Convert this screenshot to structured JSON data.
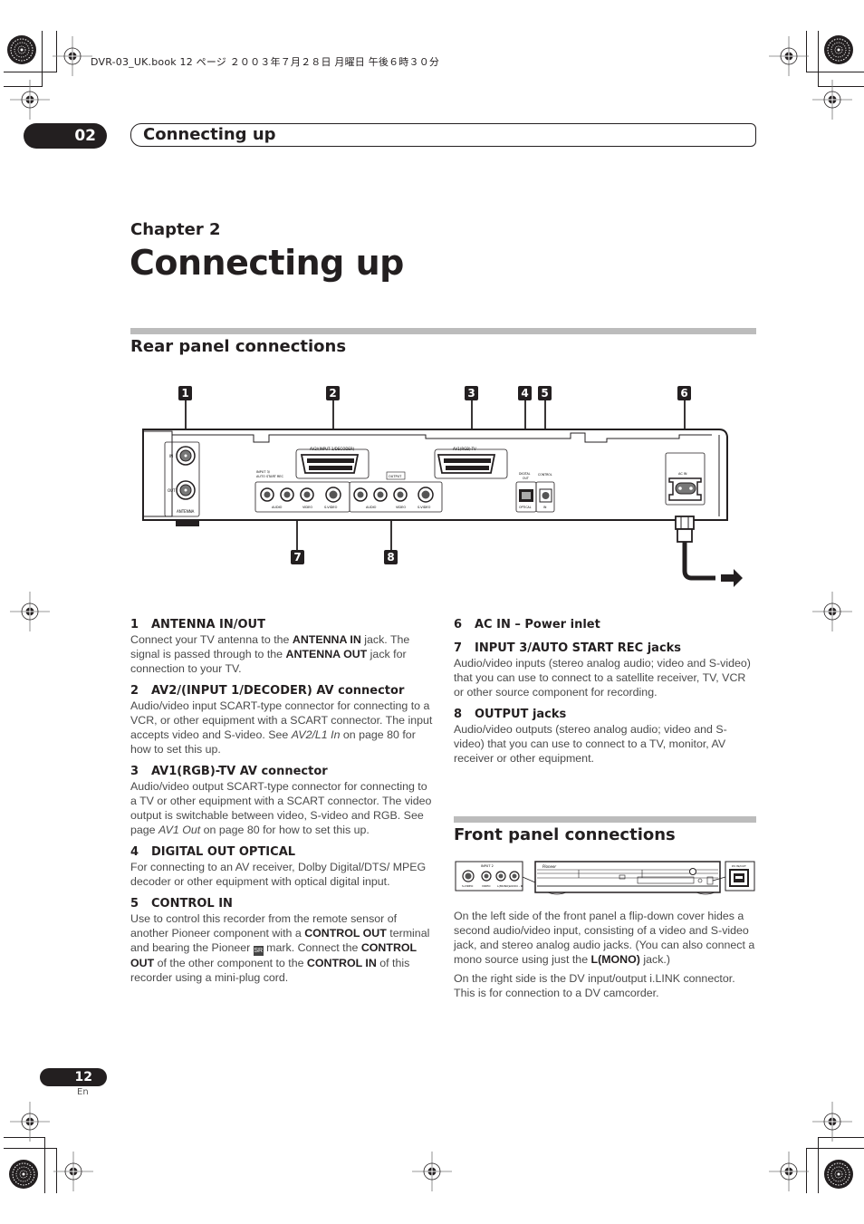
{
  "print_header": "DVR-03_UK.book  12 ページ  ２００３年７月２８日  月曜日  午後６時３０分",
  "chapter_header": {
    "number": "02",
    "title": "Connecting up"
  },
  "chapter_label": "Chapter 2",
  "page_title": "Connecting up",
  "rear_panel": {
    "title": "Rear panel connections",
    "callouts": [
      "1",
      "2",
      "3",
      "4",
      "5",
      "6",
      "7",
      "8"
    ],
    "diagram_labels": {
      "antenna_in": "IN",
      "antenna_out": "OUT",
      "antenna": "ANTENNA",
      "av2": "AV2/(INPUT 1/DECODER)",
      "av1": "AV1(RGB)-TV",
      "input3_line1": "INPUT 3/",
      "input3_line2": "AUTO START REC",
      "output": "OUTPUT",
      "r": "R",
      "l": "L",
      "audio": "AUDIO",
      "video": "VIDEO",
      "svideo": "S-VIDEO",
      "digital_out_1": "DIGITAL",
      "digital_out_2": "OUT",
      "optical": "OPTICAL",
      "control": "CONTROL",
      "control_in": "IN",
      "ac_in": "AC IN"
    },
    "items_left": [
      {
        "num": "1",
        "title": "ANTENNA IN/OUT",
        "body": [
          {
            "t": "Connect your TV antenna to the "
          },
          {
            "t": "ANTENNA IN",
            "s": "b"
          },
          {
            "t": " jack. The signal is passed through to the "
          },
          {
            "t": "ANTENNA OUT",
            "s": "b"
          },
          {
            "t": " jack for connection to your TV."
          }
        ]
      },
      {
        "num": "2",
        "title": "AV2/(INPUT 1/DECODER) AV connector",
        "body": [
          {
            "t": "Audio/video input SCART-type connector for connecting to a VCR, or other equipment with a SCART connector. The input accepts video and S-video. See "
          },
          {
            "t": "AV2/L1 In",
            "s": "i"
          },
          {
            "t": " on page 80 for how to set this up."
          }
        ]
      },
      {
        "num": "3",
        "title": "AV1(RGB)-TV AV connector",
        "body": [
          {
            "t": "Audio/video output SCART-type connector for connecting to a TV or other equipment with a SCART connector. The video output is switchable between video, S-video and RGB. See page "
          },
          {
            "t": "AV1 Out",
            "s": "i"
          },
          {
            "t": " on page 80 for how to set this up."
          }
        ]
      },
      {
        "num": "4",
        "title": "DIGITAL OUT OPTICAL",
        "body": [
          {
            "t": "For connecting to an AV receiver, Dolby Digital/DTS/ MPEG decoder or other equipment with optical digital input."
          }
        ]
      },
      {
        "num": "5",
        "title": "CONTROL IN",
        "body": [
          {
            "t": "Use to control this recorder from the remote sensor of another Pioneer component with a "
          },
          {
            "t": "CONTROL OUT",
            "s": "b"
          },
          {
            "t": " terminal and bearing the Pioneer "
          },
          {
            "t": "SR",
            "s": "mark"
          },
          {
            "t": " mark. Connect the "
          },
          {
            "t": "CONTROL OUT",
            "s": "b"
          },
          {
            "t": " of the other component to the "
          },
          {
            "t": "CONTROL IN",
            "s": "b"
          },
          {
            "t": " of this recorder using a mini-plug cord."
          }
        ]
      }
    ],
    "items_right": [
      {
        "num": "6",
        "title": "AC IN – Power inlet",
        "body": []
      },
      {
        "num": "7",
        "title": "INPUT 3/AUTO START REC jacks",
        "body": [
          {
            "t": "Audio/video inputs (stereo analog audio; video and S-video) that you can use to connect to a satellite receiver, TV, VCR or other source component for recording."
          }
        ]
      },
      {
        "num": "8",
        "title": "OUTPUT jacks",
        "body": [
          {
            "t": "Audio/video outputs (stereo analog audio; video and S-video) that you can use to connect to a TV, monitor, AV receiver or other equipment."
          }
        ]
      }
    ]
  },
  "front_panel": {
    "title": "Front panel connections",
    "diagram_labels": {
      "input2": "INPUT 2",
      "svideo": "S-VIDEO",
      "video": "VIDEO",
      "l_mono": "L(MONO)",
      "audio_r": "AUDIO - R",
      "dv_in": "DV IN/OUT",
      "brand": "Pioneer"
    },
    "paragraphs": [
      [
        {
          "t": "On the left side of the front panel a flip-down cover hides a second audio/video input, consisting of a video and S-video jack, and stereo analog audio jacks. (You can also connect a mono source using just the "
        },
        {
          "t": "L(MONO)",
          "s": "b"
        },
        {
          "t": " jack.)"
        }
      ],
      [
        {
          "t": "On the right side is the DV input/output i.LINK connector. This is for connection to a DV camcorder."
        }
      ]
    ]
  },
  "footer": {
    "page_number": "12",
    "language": "En"
  }
}
